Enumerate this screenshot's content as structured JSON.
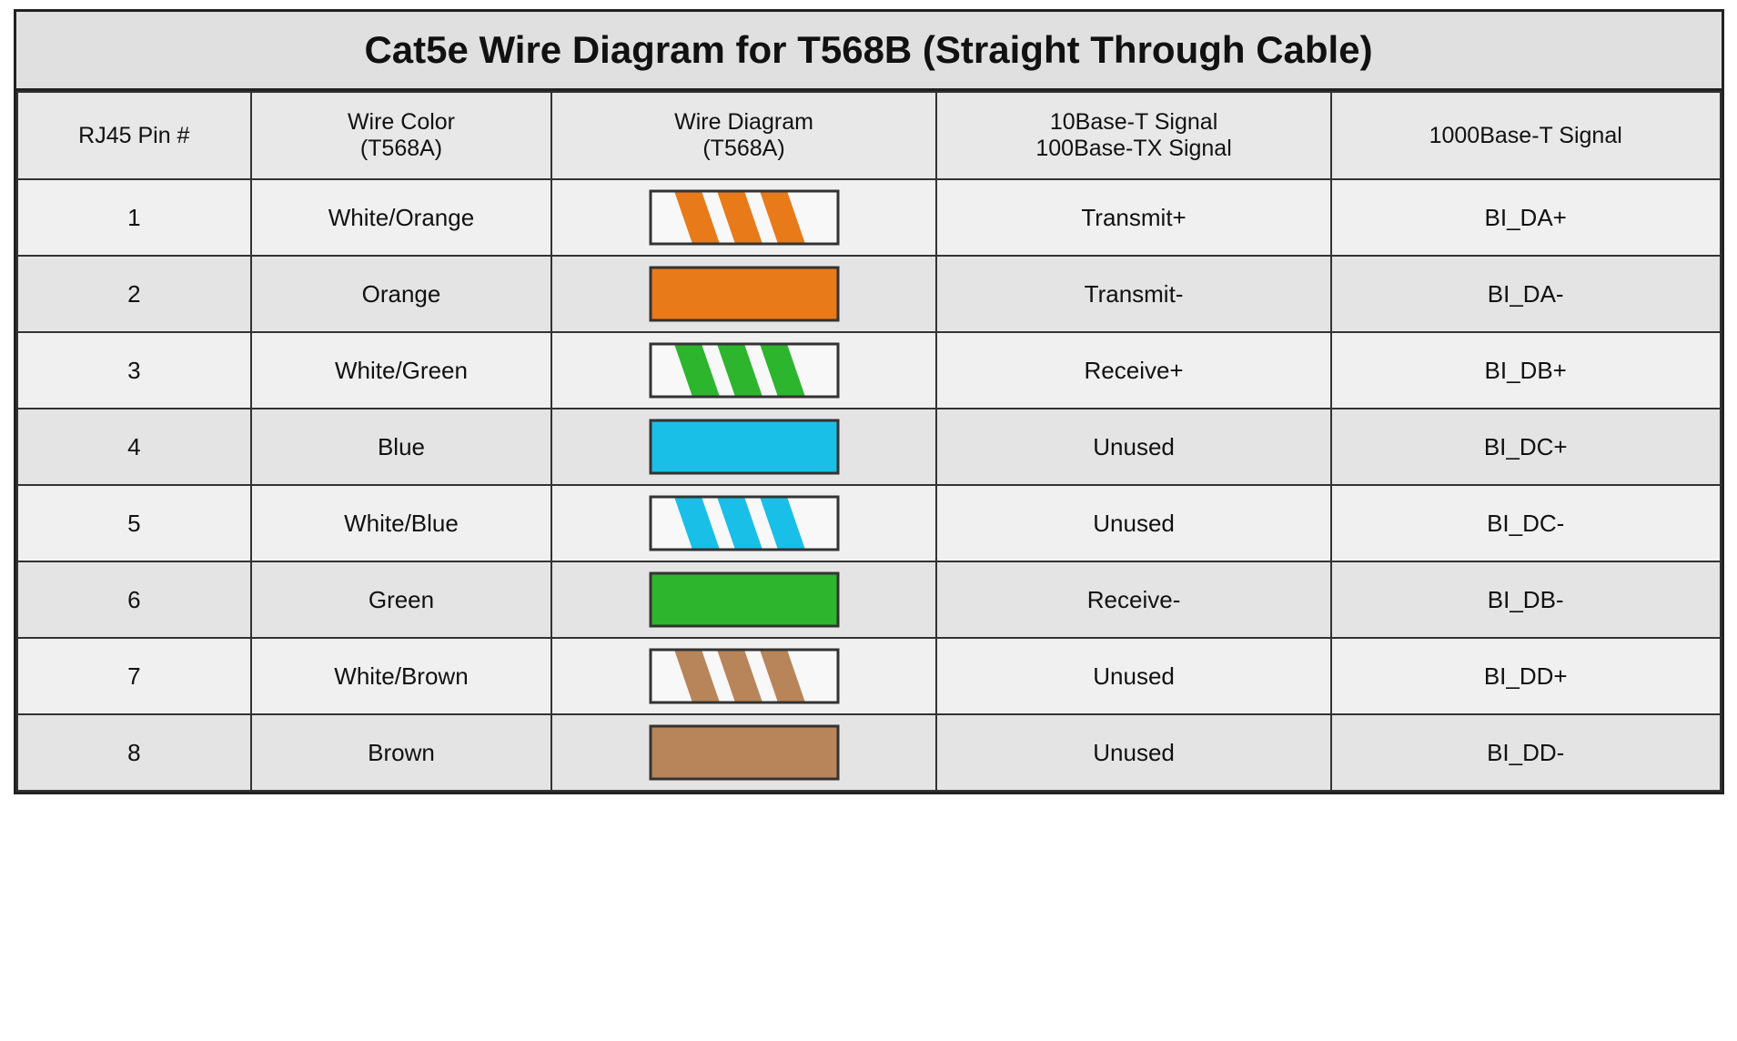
{
  "title": "Cat5e Wire Diagram for T568B (Straight Through Cable)",
  "headers": {
    "pin": "RJ45 Pin #",
    "color": "Wire Color\n(T568A)",
    "diagram": "Wire Diagram\n(T568A)",
    "signal_10_100": "10Base-T Signal\n100Base-TX Signal",
    "signal_1000": "1000Base-T Signal"
  },
  "rows": [
    {
      "pin": "1",
      "color": "White/Orange",
      "wire_type": "striped",
      "wire_color": "#E87A1A",
      "signal_10_100": "Transmit+",
      "signal_1000": "BI_DA+"
    },
    {
      "pin": "2",
      "color": "Orange",
      "wire_type": "solid",
      "wire_color": "#E87A1A",
      "signal_10_100": "Transmit-",
      "signal_1000": "BI_DA-"
    },
    {
      "pin": "3",
      "color": "White/Green",
      "wire_type": "striped",
      "wire_color": "#2DB52D",
      "signal_10_100": "Receive+",
      "signal_1000": "BI_DB+"
    },
    {
      "pin": "4",
      "color": "Blue",
      "wire_type": "solid",
      "wire_color": "#1ABFE8",
      "signal_10_100": "Unused",
      "signal_1000": "BI_DC+"
    },
    {
      "pin": "5",
      "color": "White/Blue",
      "wire_type": "striped",
      "wire_color": "#1ABFE8",
      "signal_10_100": "Unused",
      "signal_1000": "BI_DC-"
    },
    {
      "pin": "6",
      "color": "Green",
      "wire_type": "solid",
      "wire_color": "#2DB52D",
      "signal_10_100": "Receive-",
      "signal_1000": "BI_DB-"
    },
    {
      "pin": "7",
      "color": "White/Brown",
      "wire_type": "striped",
      "wire_color": "#B8855A",
      "signal_10_100": "Unused",
      "signal_1000": "BI_DD+"
    },
    {
      "pin": "8",
      "color": "Brown",
      "wire_type": "solid",
      "wire_color": "#B8855A",
      "signal_10_100": "Unused",
      "signal_1000": "BI_DD-"
    }
  ]
}
